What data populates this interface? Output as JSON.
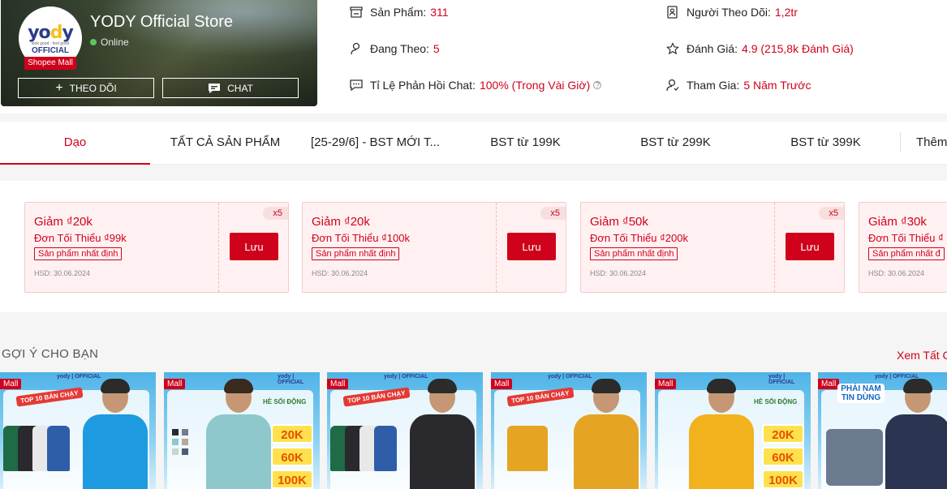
{
  "shop": {
    "name": "YODY Official Store",
    "status": "Online",
    "logo": {
      "brand": "yody",
      "tagline": "look good · feel good",
      "official": "OFFICIAL"
    },
    "mall_tag": "Shopee Mall",
    "follow_label": "THEO DÕI",
    "chat_label": "CHAT"
  },
  "stats": {
    "products_label": "Sản Phẩm:",
    "products_value": "311",
    "following_label": "Đang Theo:",
    "following_value": "5",
    "chat_rate_label": "Tỉ Lệ Phản Hồi Chat:",
    "chat_rate_value": "100% (Trong Vài Giờ)",
    "followers_label": "Người Theo Dõi:",
    "followers_value": "1,2tr",
    "rating_label": "Đánh Giá:",
    "rating_value": "4.9 (215,8k Đánh Giá)",
    "joined_label": "Tham Gia:",
    "joined_value": "5 Năm Trước"
  },
  "tabs": [
    {
      "label": "Dạo"
    },
    {
      "label": "TẤT CẢ SẢN PHẨM"
    },
    {
      "label": "[25-29/6] - BST MỚI T..."
    },
    {
      "label": "BST từ 199K"
    },
    {
      "label": "BST từ 299K"
    },
    {
      "label": "BST từ 399K"
    },
    {
      "label": "Thêm"
    }
  ],
  "vouchers": [
    {
      "title": "Giảm ₫20k",
      "min": "Đơn Tối Thiểu ₫99k",
      "cond": "Sản phẩm nhất định",
      "hsd": "HSD: 30.06.2024",
      "qty": "x5",
      "save": "Lưu"
    },
    {
      "title": "Giảm ₫20k",
      "min": "Đơn Tối Thiểu ₫100k",
      "cond": "Sản phẩm nhất định",
      "hsd": "HSD: 30.06.2024",
      "qty": "x5",
      "save": "Lưu"
    },
    {
      "title": "Giảm ₫50k",
      "min": "Đơn Tối Thiểu ₫200k",
      "cond": "Sản phẩm nhất định",
      "hsd": "HSD: 30.06.2024",
      "qty": "x5",
      "save": "Lưu"
    },
    {
      "title": "Giảm ₫30k",
      "min": "Đơn Tối Thiểu ₫",
      "cond": "Sản phẩm nhất đ",
      "hsd": "HSD: 30.06.2024",
      "qty": "x5",
      "save": "Lưu"
    }
  ],
  "recommend": {
    "title": "GỢI Ý CHO BẠN",
    "see_all": "Xem Tất C"
  },
  "products": [
    {
      "mall": "Mall",
      "brand": "yody | OFFICIAL",
      "badge": "TOP 10 BÁN CHẠY",
      "shirt_color": "#1e9be0"
    },
    {
      "mall": "Mall",
      "brand": "yody | OFFICIAL",
      "promo": "HÈ SỐI ĐỘNG",
      "prices": [
        "20K",
        "60K",
        "100K"
      ],
      "shirt_color": "#8ec7cc"
    },
    {
      "mall": "Mall",
      "brand": "yody | OFFICIAL",
      "badge": "TOP 10 BÁN CHẠY",
      "shirt_color": "#2a2a2e"
    },
    {
      "mall": "Mall",
      "brand": "yody | OFFICIAL",
      "badge": "TOP 10 BÁN CHẠY",
      "shirt_color": "#e5a424"
    },
    {
      "mall": "Mall",
      "brand": "yody | OFFICIAL",
      "promo": "HÈ SỐI ĐỘNG",
      "prices": [
        "20K",
        "60K",
        "100K"
      ],
      "shirt_color": "#f2b21e"
    },
    {
      "mall": "Mall",
      "brand": "yody | OFFICIAL",
      "badge": "PHÁI NAM TIN DÙNG",
      "shirt_color": "#2b3450"
    }
  ],
  "colors": {
    "accent": "#d0011b",
    "voucher_bg": "#fff1f1"
  }
}
